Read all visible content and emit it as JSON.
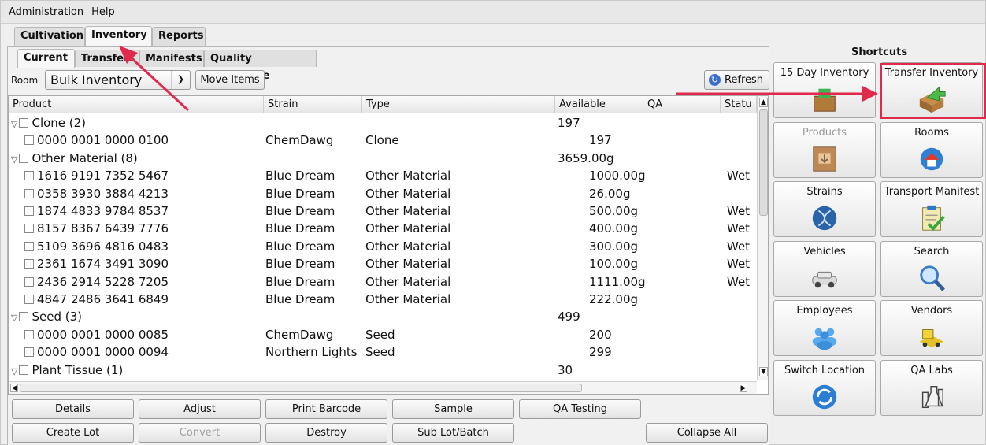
{
  "menu": [
    "Administration",
    "Help"
  ],
  "main_tabs": [
    "Cultivation",
    "Inventory",
    "Reports"
  ],
  "sub_tabs": [
    "Current",
    "Transfers",
    "Manifests",
    "Quality Assurance"
  ],
  "toolbar": {
    "room_label": "Room",
    "room_value": "Bulk Inventory",
    "move_items": "Move Items",
    "refresh": "Refresh"
  },
  "columns": [
    "Product",
    "Strain",
    "Type",
    "Available",
    "QA",
    "Statu"
  ],
  "rows": [
    {
      "level": 0,
      "product": "Clone (2)",
      "strain": "",
      "type": "",
      "available": "197",
      "status": ""
    },
    {
      "level": 1,
      "product": "0000 0001 0000 0100",
      "strain": "ChemDawg",
      "type": "Clone",
      "available": "197",
      "status": ""
    },
    {
      "level": 0,
      "product": "Other Material (8)",
      "strain": "",
      "type": "",
      "available": "3659.00g",
      "status": ""
    },
    {
      "level": 1,
      "product": "1616 9191 7352 5467",
      "strain": "Blue Dream",
      "type": "Other Material",
      "available": "1000.00g",
      "status": "Wet"
    },
    {
      "level": 1,
      "product": "0358 3930 3884 4213",
      "strain": "Blue Dream",
      "type": "Other Material",
      "available": "26.00g",
      "status": ""
    },
    {
      "level": 1,
      "product": "1874 4833 9784 8537",
      "strain": "Blue Dream",
      "type": "Other Material",
      "available": "500.00g",
      "status": "Wet"
    },
    {
      "level": 1,
      "product": "8157 8367 6439 7776",
      "strain": "Blue Dream",
      "type": "Other Material",
      "available": "400.00g",
      "status": "Wet"
    },
    {
      "level": 1,
      "product": "5109 3696 4816 0483",
      "strain": "Blue Dream",
      "type": "Other Material",
      "available": "300.00g",
      "status": "Wet"
    },
    {
      "level": 1,
      "product": "2361 1674 3491 3090",
      "strain": "Blue Dream",
      "type": "Other Material",
      "available": "100.00g",
      "status": "Wet"
    },
    {
      "level": 1,
      "product": "2436 2914 5228 7205",
      "strain": "Blue Dream",
      "type": "Other Material",
      "available": "1111.00g",
      "status": "Wet"
    },
    {
      "level": 1,
      "product": "4847 2486 3641 6849",
      "strain": "Blue Dream",
      "type": "Other Material",
      "available": "222.00g",
      "status": ""
    },
    {
      "level": 0,
      "product": "Seed (3)",
      "strain": "",
      "type": "",
      "available": "499",
      "status": ""
    },
    {
      "level": 1,
      "product": "0000 0001 0000 0085",
      "strain": "ChemDawg",
      "type": "Seed",
      "available": "200",
      "status": ""
    },
    {
      "level": 1,
      "product": "0000 0001 0000 0094",
      "strain": "Northern Lights",
      "type": "Seed",
      "available": "299",
      "status": ""
    },
    {
      "level": 0,
      "product": "Plant Tissue (1)",
      "strain": "",
      "type": "",
      "available": "30",
      "status": ""
    }
  ],
  "buttons_row1": [
    {
      "label": "Details",
      "enabled": true
    },
    {
      "label": "Adjust",
      "enabled": true
    },
    {
      "label": "Print Barcode",
      "enabled": true
    },
    {
      "label": "Sample",
      "enabled": true
    },
    {
      "label": "QA Testing",
      "enabled": true
    }
  ],
  "buttons_row2": [
    {
      "label": "Create Lot",
      "enabled": true
    },
    {
      "label": "Convert",
      "enabled": false
    },
    {
      "label": "Destroy",
      "enabled": true
    },
    {
      "label": "Sub Lot/Batch",
      "enabled": true
    },
    {
      "label": "Collapse All",
      "enabled": true
    }
  ],
  "shortcuts": {
    "title": "Shortcuts",
    "items": [
      {
        "label": "15 Day Inventory",
        "icon": "inventory-box-icon",
        "enabled": true
      },
      {
        "label": "Transfer Inventory",
        "icon": "transfer-box-icon",
        "enabled": true,
        "highlighted": true
      },
      {
        "label": "Products",
        "icon": "products-box-icon",
        "enabled": false
      },
      {
        "label": "Rooms",
        "icon": "rooms-house-icon",
        "enabled": true
      },
      {
        "label": "Strains",
        "icon": "strains-dna-icon",
        "enabled": true
      },
      {
        "label": "Transport Manifest",
        "icon": "manifest-clipboard-icon",
        "enabled": true
      },
      {
        "label": "Vehicles",
        "icon": "vehicle-car-icon",
        "enabled": true
      },
      {
        "label": "Search",
        "icon": "magnifier-icon",
        "enabled": true
      },
      {
        "label": "Employees",
        "icon": "employees-people-icon",
        "enabled": true
      },
      {
        "label": "Vendors",
        "icon": "vendors-truck-icon",
        "enabled": true
      },
      {
        "label": "Switch Location",
        "icon": "switch-arrows-icon",
        "enabled": true
      },
      {
        "label": "QA Labs",
        "icon": "lab-flask-icon",
        "enabled": true
      }
    ]
  },
  "annotation_color": "#e0294b"
}
